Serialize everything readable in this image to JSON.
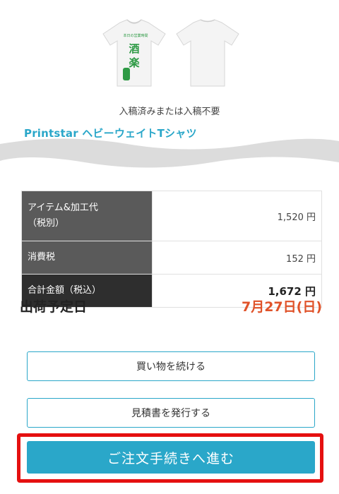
{
  "product": {
    "manuscript_status": "入稿済みまたは入稿不要",
    "name": "Printstar ヘビーウェイトTシャツ",
    "print_text_main": "酒楽",
    "print_text_small": "本日の営業時間"
  },
  "prices": [
    {
      "label_line1": "アイテム&加工代",
      "label_line2": "（税別）",
      "value": "1,520 円"
    },
    {
      "label_line1": "消費税",
      "label_line2": "",
      "value": "152 円"
    },
    {
      "label_line1": "合計金額（税込）",
      "label_line2": "",
      "value": "1,672 円"
    }
  ],
  "shipping": {
    "label": "出荷予定日",
    "date": "7月27日(日)"
  },
  "buttons": {
    "continue": "買い物を続ける",
    "estimate": "見積書を発行する",
    "order": "ご注文手続きへ進む"
  },
  "colors": {
    "accent": "#2aa7c9",
    "date": "#e0532a",
    "highlight_frame": "#e51010",
    "print_green": "#2e9a45"
  }
}
